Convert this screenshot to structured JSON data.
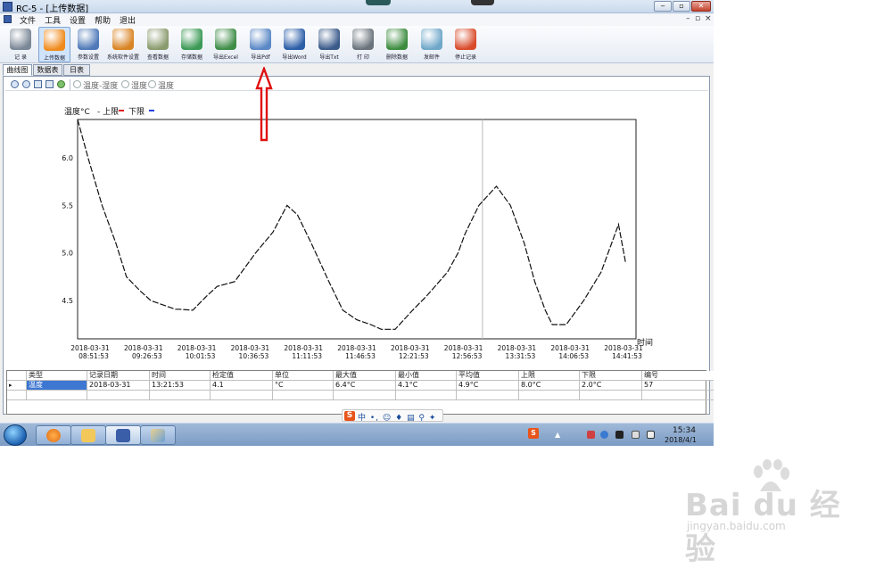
{
  "window": {
    "title": "RC-5 - [上传数据]"
  },
  "menu": {
    "items": [
      "文件",
      "工具",
      "设置",
      "帮助",
      "退出"
    ]
  },
  "toolbar": {
    "items": [
      {
        "label": "记 录",
        "icon": "app-icon",
        "color": "#7a8796"
      },
      {
        "label": "上传数据",
        "icon": "globe-upload-icon",
        "color": "#f08a1c"
      },
      {
        "label": "参数设置",
        "icon": "gear-icon",
        "color": "#4f79b8"
      },
      {
        "label": "系统软件设置",
        "icon": "settings-icon",
        "color": "#d98424"
      },
      {
        "label": "查看数据",
        "icon": "view-data-icon",
        "color": "#8a9b6e"
      },
      {
        "label": "存储数据",
        "icon": "save-data-icon",
        "color": "#3c9a56"
      },
      {
        "label": "导出Excel",
        "icon": "excel-icon",
        "color": "#3f8d48"
      },
      {
        "label": "导出Pdf",
        "icon": "pdf-icon",
        "color": "#5b88c6"
      },
      {
        "label": "导出Word",
        "icon": "word-icon",
        "color": "#2c5ea8"
      },
      {
        "label": "导出Txt",
        "icon": "txt-icon",
        "color": "#3a5a8a"
      },
      {
        "label": "打 印",
        "icon": "printer-icon",
        "color": "#6a737c"
      },
      {
        "label": "删除数据",
        "icon": "trash-icon",
        "color": "#3d8c3f"
      },
      {
        "label": "发邮件",
        "icon": "mail-icon",
        "color": "#6fa7c9"
      },
      {
        "label": "停止记录",
        "icon": "stop-record-icon",
        "color": "#d94b2b"
      }
    ]
  },
  "tabs": [
    "曲线图",
    "数据表",
    "日表"
  ],
  "options": {
    "radio1": "温度-湿度",
    "radio2": "湿度",
    "radio3": "温度"
  },
  "chart_data": {
    "type": "line",
    "legend": {
      "title": "温度°C",
      "upper": "上限",
      "lower": "下限",
      "upper_color": "#e02020",
      "lower_color": "#2040e0"
    },
    "xlabel": "时间",
    "ylim": [
      4.1,
      6.4
    ],
    "yticks": [
      "4.5",
      "5.0",
      "5.5",
      "6.0"
    ],
    "yvals": [
      4.5,
      5.0,
      5.5,
      6.0
    ],
    "xtick_dates": [
      "2018-03-31",
      "2018-03-31",
      "2018-03-31",
      "2018-03-31",
      "2018-03-31",
      "2018-03-31",
      "2018-03-31",
      "2018-03-31",
      "2018-03-31",
      "2018-03-31",
      "2018-03-31"
    ],
    "xtick_times": [
      "08:51:53",
      "09:26:53",
      "10:01:53",
      "10:36:53",
      "11:11:53",
      "11:46:53",
      "12:21:53",
      "12:56:53",
      "13:31:53",
      "14:06:53",
      "14:41:53"
    ],
    "x": [
      0,
      3,
      7,
      11,
      14,
      18,
      21,
      28,
      29,
      33,
      37,
      40,
      45,
      48,
      51,
      56,
      60,
      63,
      67,
      72,
      76,
      80,
      84,
      87,
      91,
      96,
      100,
      106,
      109,
      111,
      115,
      120,
      124,
      128,
      131,
      134,
      136,
      140,
      145,
      150,
      155,
      157
    ],
    "y": [
      6.4,
      6.0,
      5.5,
      5.1,
      4.75,
      4.6,
      4.5,
      4.41,
      4.41,
      4.4,
      4.55,
      4.65,
      4.7,
      4.85,
      5.0,
      5.22,
      5.5,
      5.4,
      5.1,
      4.7,
      4.4,
      4.3,
      4.25,
      4.2,
      4.2,
      4.4,
      4.55,
      4.8,
      5.0,
      5.2,
      5.5,
      5.7,
      5.5,
      5.1,
      4.7,
      4.4,
      4.25,
      4.25,
      4.5,
      4.8,
      5.3,
      4.9
    ],
    "marker_x": 116
  },
  "grid": {
    "columns": [
      "类型",
      "记录日期",
      "时间",
      "检定值",
      "单位",
      "最大值",
      "最小值",
      "平均值",
      "上限",
      "下限",
      "编号"
    ],
    "row": [
      "温度",
      "2018-03-31",
      "13:21:53",
      "4.1",
      "°C",
      "6.4°C",
      "4.1°C",
      "4.9°C",
      "8.0°C",
      "2.0°C",
      "57"
    ],
    "row_marker": "▸"
  },
  "ime": {
    "logo": "S",
    "text": "中 •, ☺ ♦ ▤ ⚲ ✦ ✎"
  },
  "taskbar": {
    "time": "15:34",
    "date": "2018/4/1",
    "tray_s": "S"
  },
  "watermark": {
    "main": "Bai du 经验",
    "sub": "jingyan.baidu.com"
  }
}
